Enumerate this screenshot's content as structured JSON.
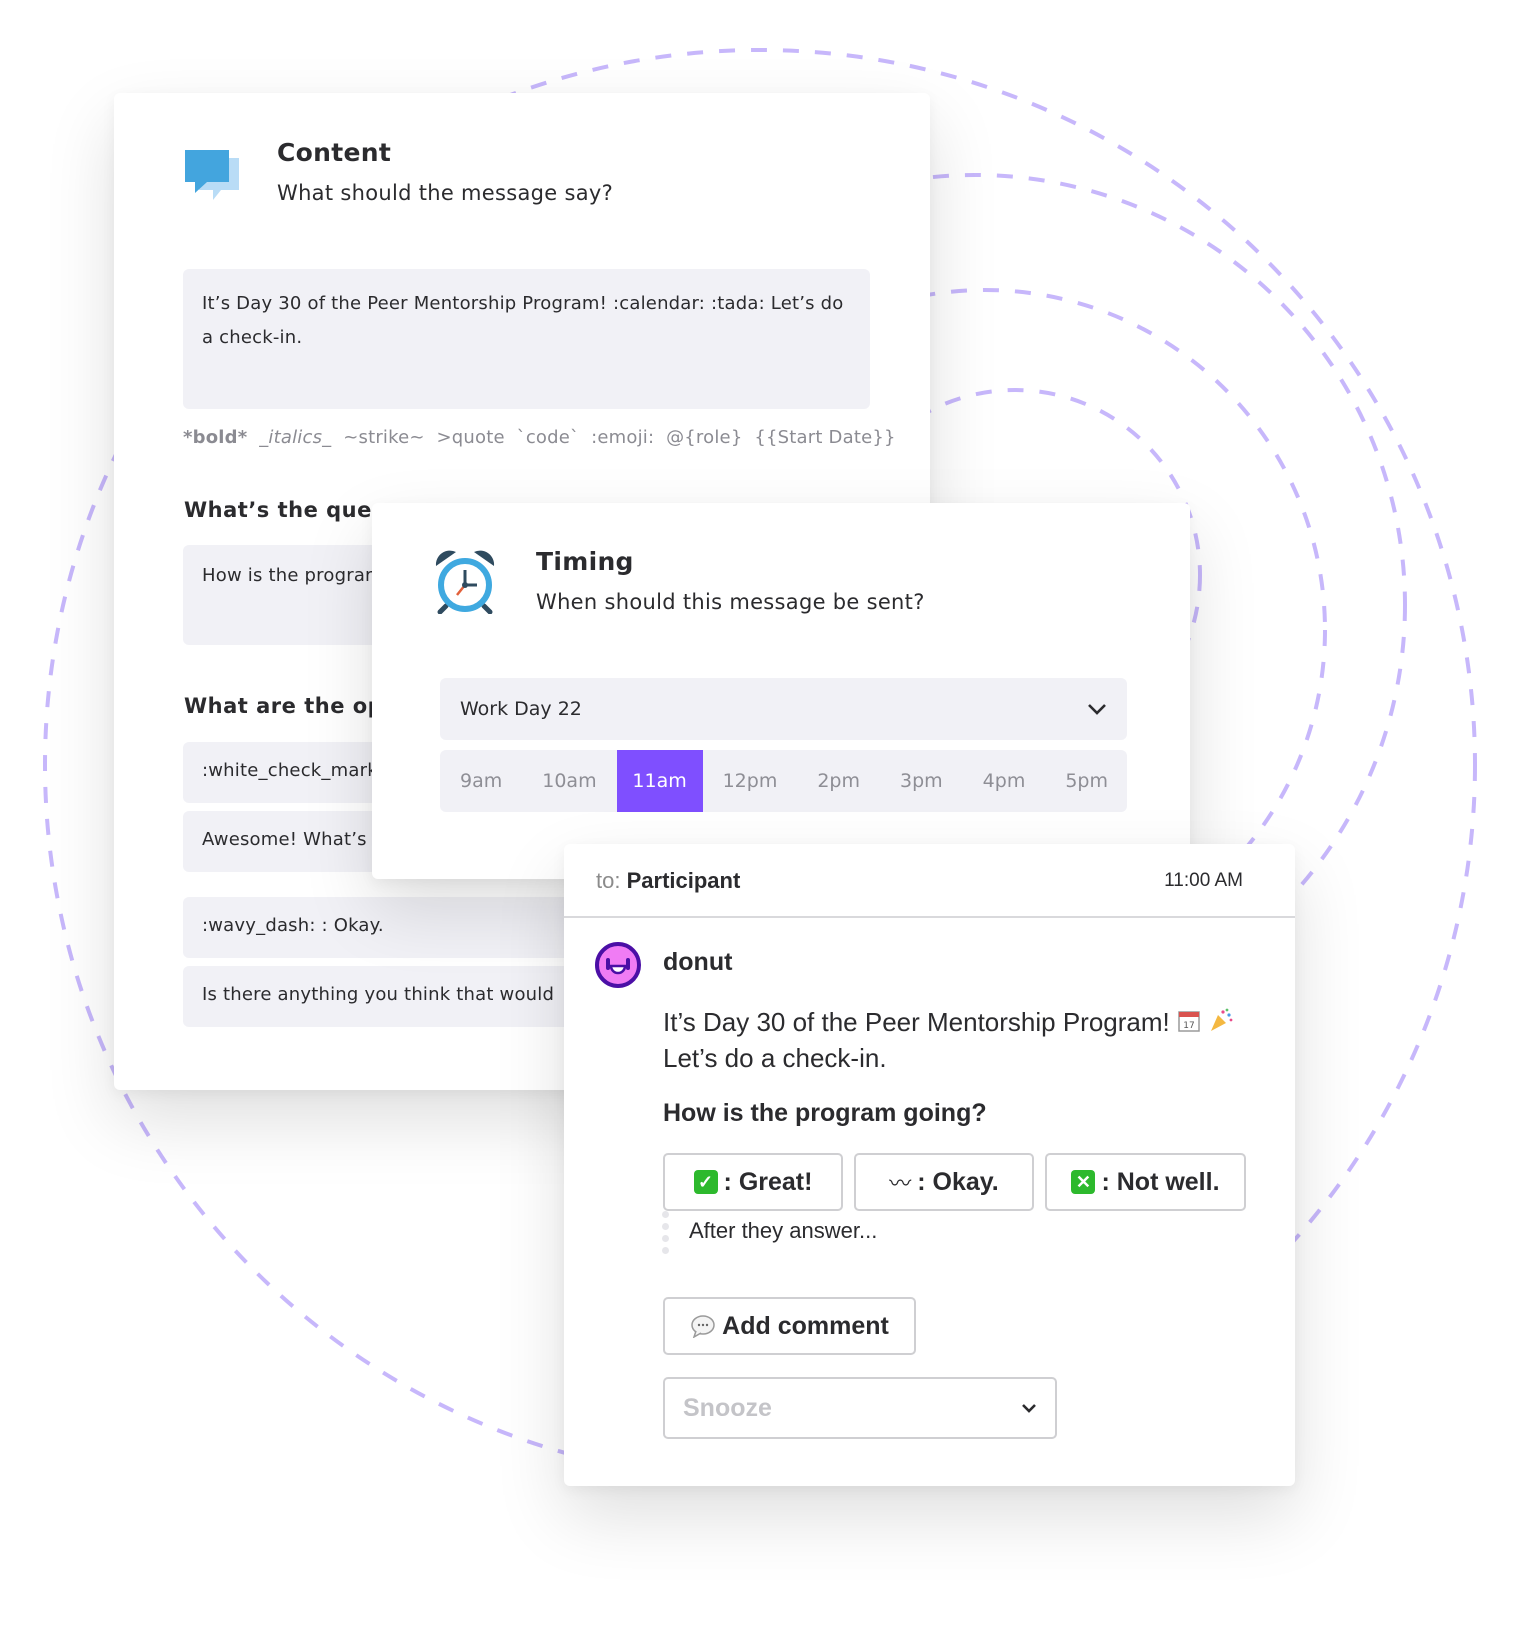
{
  "theme": {
    "accent": "#7f4fff",
    "ring_color": "#c7b7fb",
    "field_bg": "#f1f1f6",
    "avatar_fill": "#f07cf4",
    "avatar_stroke": "#4b0fa6"
  },
  "content_card": {
    "icon": "speech-bubbles-icon",
    "title": "Content",
    "subtitle": "What should the message say?",
    "message_value": "It’s Day 30 of the Peer Mentorship Program! :calendar: :tada: Let’s do a check-in.",
    "formatting_hints": {
      "bold": "*bold*",
      "italics": "_italics_",
      "strike": "~strike~",
      "quote": ">quote",
      "code": "`code`",
      "emoji": ":emoji:",
      "role": "@{role}",
      "start_date": "{{Start Date}}"
    },
    "question_label": "What’s the ques",
    "question_value": "How is the prograr",
    "options_label": "What are the op",
    "options": [
      ":white_check_mark",
      "Awesome! What’s",
      ":wavy_dash: : Okay.",
      "Is there anything you think that would"
    ]
  },
  "timing_card": {
    "icon": "alarm-clock-icon",
    "title": "Timing",
    "subtitle": "When should this message be sent?",
    "day_select": "Work Day 22",
    "times": [
      "9am",
      "10am",
      "11am",
      "12pm",
      "2pm",
      "3pm",
      "4pm",
      "5pm"
    ],
    "selected_time": "11am"
  },
  "preview_card": {
    "to_label": "to:",
    "to_value": "Participant",
    "time": "11:00 AM",
    "bot_name": "donut",
    "message_line1": "It’s Day 30 of the Peer Mentorship Program!",
    "message_emojis": [
      "calendar-icon",
      "tada-icon"
    ],
    "message_line2": "Let’s do a check-in.",
    "question": "How is the program going?",
    "buttons": [
      {
        "icon": "white-check-mark-icon",
        "label": ": Great!"
      },
      {
        "icon": "wavy-dash-icon",
        "label": ": Okay."
      },
      {
        "icon": "x-mark-icon",
        "label": ": Not well."
      }
    ],
    "after_text": "After they answer...",
    "add_comment": "Add comment",
    "snooze_placeholder": "Snooze"
  }
}
